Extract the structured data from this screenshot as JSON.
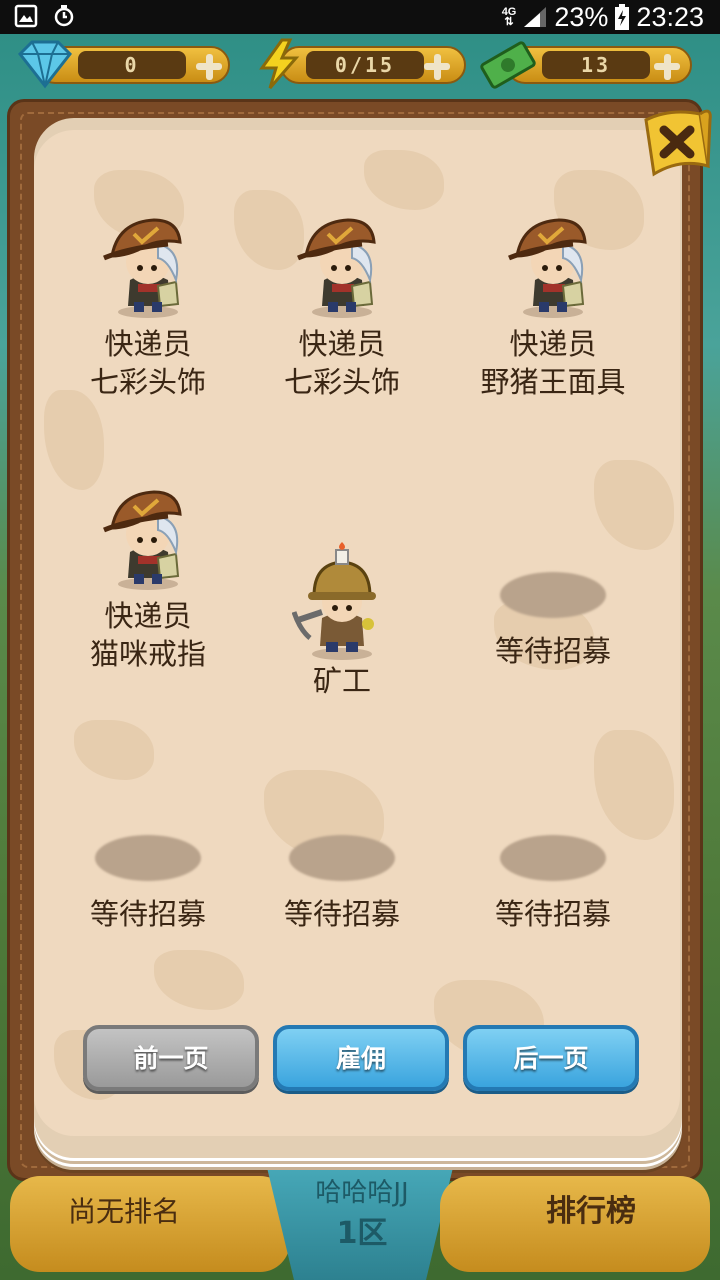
{
  "status_bar": {
    "network": "4G",
    "battery": "23%",
    "time": "23:23"
  },
  "resources": {
    "gems": "0",
    "energy": "0/15",
    "cash": "13"
  },
  "slots": [
    {
      "name": "快递员",
      "item": "七彩头饰",
      "type": "courier"
    },
    {
      "name": "快递员",
      "item": "七彩头饰",
      "type": "courier"
    },
    {
      "name": "快递员",
      "item": "野猪王面具",
      "type": "courier"
    },
    {
      "name": "快递员",
      "item": "猫咪戒指",
      "type": "courier"
    },
    {
      "name": "矿工",
      "item": "",
      "type": "miner"
    },
    {
      "name": "等待招募",
      "item": "",
      "type": "empty"
    },
    {
      "name": "等待招募",
      "item": "",
      "type": "empty"
    },
    {
      "name": "等待招募",
      "item": "",
      "type": "empty"
    },
    {
      "name": "等待招募",
      "item": "",
      "type": "empty"
    }
  ],
  "buttons": {
    "prev": "前一页",
    "hire": "雇佣",
    "next": "后一页"
  },
  "bottom_bar": {
    "rank": "尚无排名",
    "player": "哈哈哈JJ",
    "zone": "1区",
    "leaderboard": "排行榜"
  },
  "colors": {
    "book_page": "#efd9bf",
    "frame": "#7a4a26",
    "button_blue": "#3aa4de",
    "button_gray": "#9a9a9a"
  }
}
